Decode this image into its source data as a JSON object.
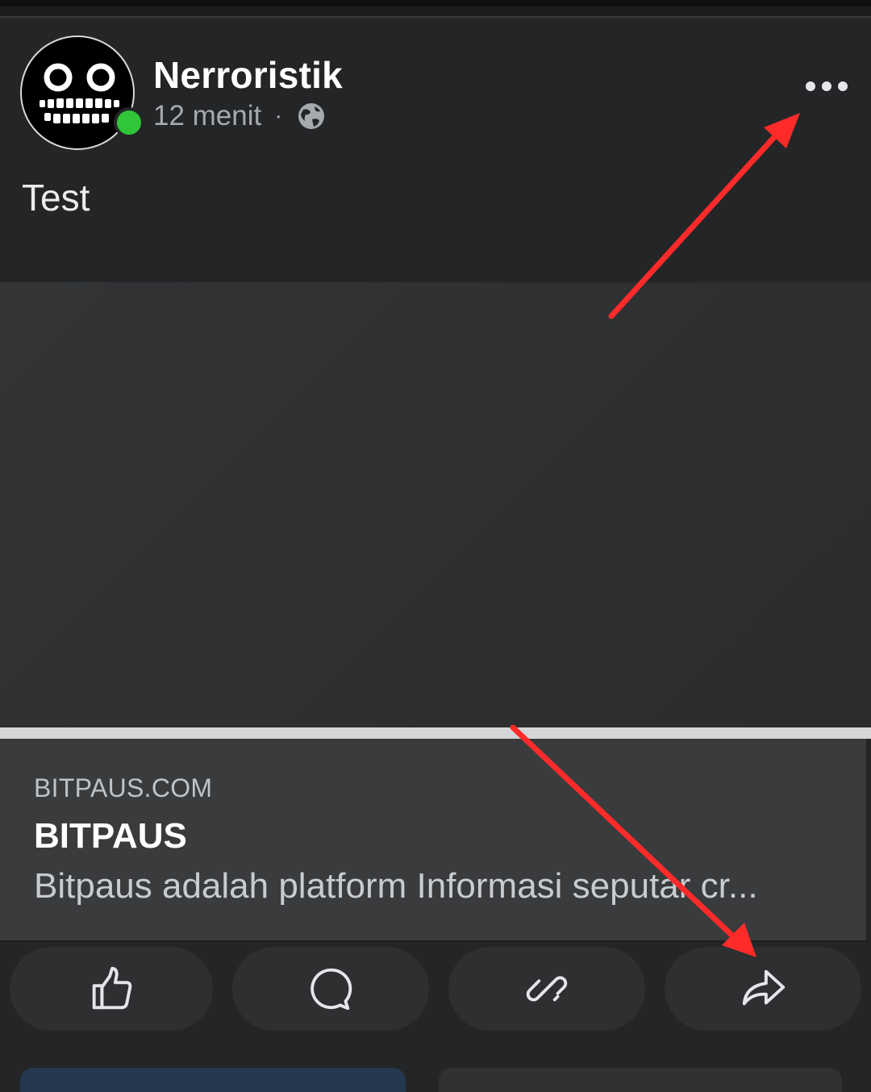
{
  "post": {
    "author_name": "Nerroristik",
    "time": "12 menit",
    "separator": "·",
    "privacy_icon": "globe-icon",
    "online_status_color": "#31c53a",
    "text": "Test"
  },
  "link_preview": {
    "domain": "BITPAUS.COM",
    "title": "BITPAUS",
    "description": "Bitpaus adalah platform Informasi seputar cr..."
  },
  "actions": [
    {
      "icon": "thumbs-up-icon"
    },
    {
      "icon": "comment-icon"
    },
    {
      "icon": "link-icon"
    },
    {
      "icon": "share-icon"
    }
  ],
  "annotations": {
    "arrow_color": "#ff2a2a"
  }
}
